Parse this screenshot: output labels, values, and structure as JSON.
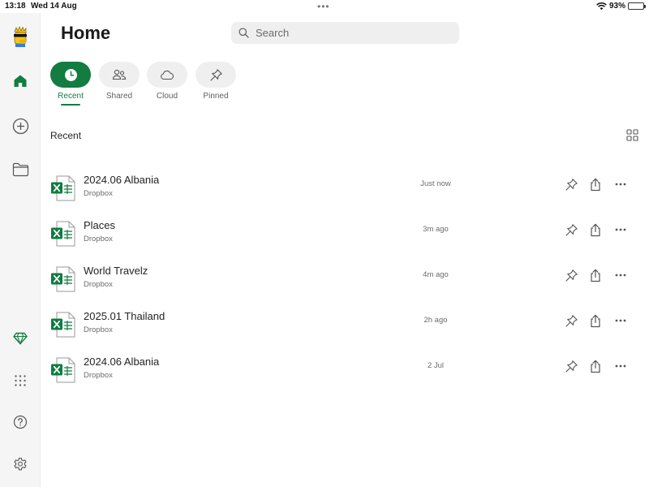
{
  "status_bar": {
    "time": "13:18",
    "date": "Wed 14 Aug",
    "battery": "93%",
    "battery_level": 0.93
  },
  "sidebar": {
    "items": [
      {
        "name": "avatar",
        "icon": "user-avatar-icon"
      },
      {
        "name": "home",
        "icon": "home-icon"
      },
      {
        "name": "create",
        "icon": "add-circle-icon"
      },
      {
        "name": "browse",
        "icon": "folder-icon"
      },
      {
        "name": "premium",
        "icon": "diamond-icon"
      },
      {
        "name": "apps",
        "icon": "app-grid-icon"
      },
      {
        "name": "help",
        "icon": "help-icon"
      },
      {
        "name": "settings",
        "icon": "gear-icon"
      }
    ]
  },
  "header": {
    "title": "Home"
  },
  "search": {
    "placeholder": "Search"
  },
  "tabs": [
    {
      "label": "Recent",
      "icon": "clock-icon",
      "active": true
    },
    {
      "label": "Shared",
      "icon": "people-icon",
      "active": false
    },
    {
      "label": "Cloud",
      "icon": "cloud-icon",
      "active": false
    },
    {
      "label": "Pinned",
      "icon": "pin-icon",
      "active": false
    }
  ],
  "section": {
    "title": "Recent"
  },
  "files": [
    {
      "name": "2024.06 Albania",
      "location": "Dropbox",
      "modified": "Just now"
    },
    {
      "name": "Places",
      "location": "Dropbox",
      "modified": "3m ago"
    },
    {
      "name": "World Travelz",
      "location": "Dropbox",
      "modified": "4m ago"
    },
    {
      "name": "2025.01 Thailand",
      "location": "Dropbox",
      "modified": "2h ago"
    },
    {
      "name": "2024.06 Albania",
      "location": "Dropbox",
      "modified": "2 Jul"
    }
  ],
  "colors": {
    "accent": "#137c41",
    "excel_green": "#107c41",
    "sidebar_bg": "#f5f5f5"
  }
}
